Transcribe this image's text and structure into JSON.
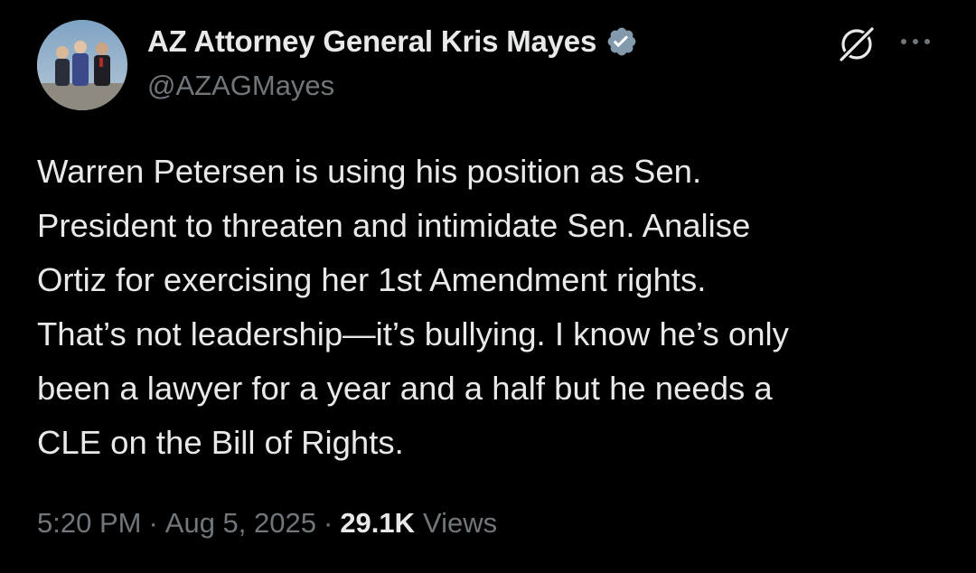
{
  "author": {
    "display_name": "AZ Attorney General Kris Mayes",
    "handle": "@AZAGMayes",
    "verified_icon": "verified-badge-icon",
    "avatar_icon": "profile-photo"
  },
  "actions": {
    "grok_icon": "grok-icon",
    "more_icon": "more-dots-icon"
  },
  "tweet": {
    "lines": [
      "Warren Petersen is using his position as Sen.",
      "President to threaten and intimidate Sen. Analise",
      "Ortiz for exercising her 1st Amendment rights.",
      "That’s not leadership—it’s bullying. I know he’s only",
      "been a lawyer for a year and a half but he needs a",
      "CLE on the Bill of Rights."
    ]
  },
  "meta": {
    "time": "5:20 PM",
    "separator": "·",
    "date": "Aug 5, 2025",
    "views_count": "29.1K",
    "views_label": "Views"
  },
  "colors": {
    "background": "#000000",
    "primary_text": "#e7e9ea",
    "secondary_text": "#71767b",
    "verified_badge": "#829aab"
  }
}
